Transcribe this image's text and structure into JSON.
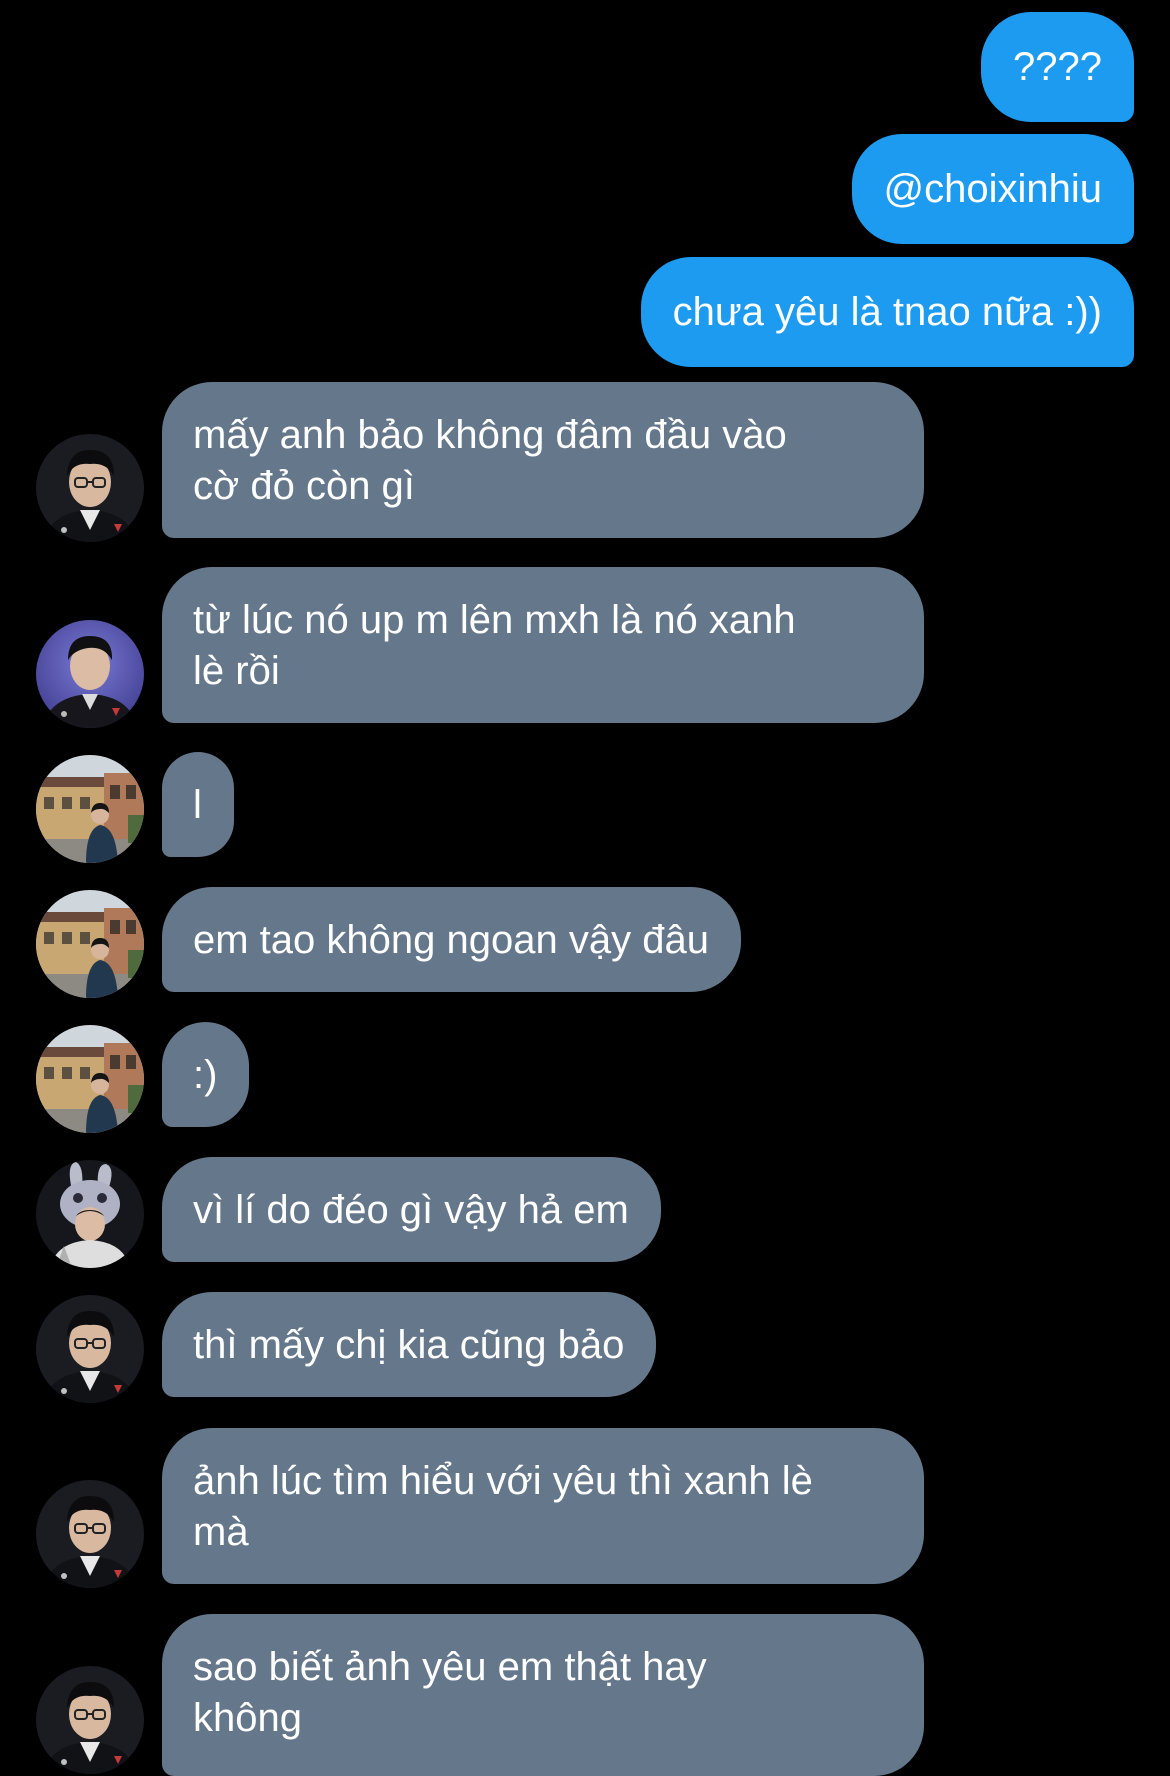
{
  "conversation": {
    "outgoing": [
      {
        "text": "????"
      },
      {
        "text": "@choixinhiu"
      },
      {
        "text": "chưa yêu là tnao nữa :))"
      }
    ],
    "incoming": [
      {
        "avatar": "avatar-man-glasses",
        "lines": [
          "mấy anh bảo không đâm đầu vào",
          "cờ đỏ còn gì"
        ]
      },
      {
        "avatar": "avatar-man-purple-bg",
        "lines": [
          "từ lúc nó up m lên mxh là nó xanh",
          "lè rồi"
        ]
      },
      {
        "avatar": "avatar-street-photo",
        "lines": [
          "l"
        ]
      },
      {
        "avatar": "avatar-street-photo",
        "lines": [
          "em tao không ngoan vậy đâu"
        ]
      },
      {
        "avatar": "avatar-street-photo",
        "lines": [
          ":)"
        ]
      },
      {
        "avatar": "avatar-bunny-hat",
        "lines": [
          "vì lí do đéo gì vậy hả em"
        ]
      },
      {
        "avatar": "avatar-man-glasses",
        "lines": [
          "thì mấy chị kia cũng bảo"
        ]
      },
      {
        "avatar": "avatar-man-glasses",
        "lines": [
          "ảnh lúc tìm hiểu với yêu thì xanh lè",
          "mà"
        ]
      },
      {
        "avatar": "avatar-man-glasses",
        "lines": [
          "sao biết ảnh yêu em thật hay",
          "không"
        ]
      }
    ]
  },
  "colors": {
    "background": "#000000",
    "outgoing_bubble": "#1d9bf0",
    "incoming_bubble": "#65778a",
    "text": "#ffffff"
  }
}
